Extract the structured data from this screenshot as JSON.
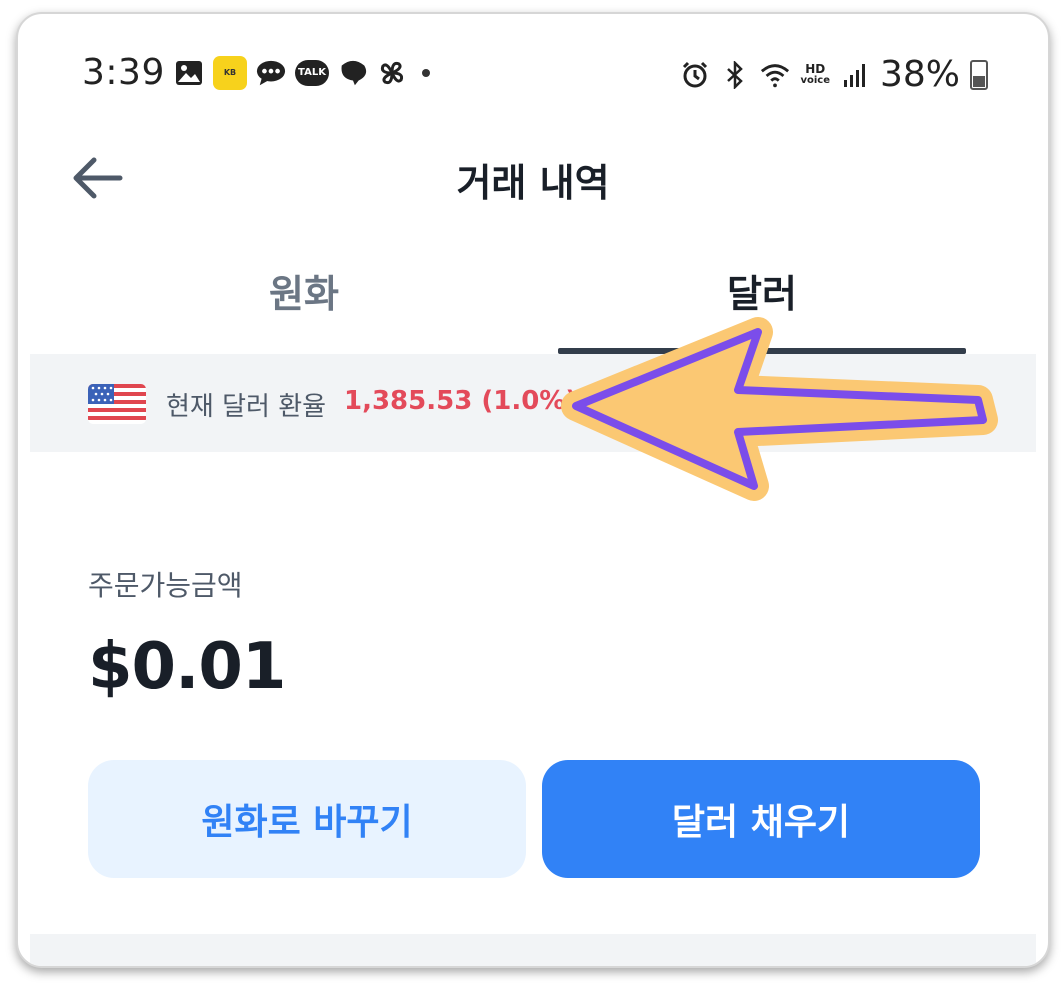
{
  "status_bar": {
    "time": "3:39",
    "kb_label": "KB",
    "talk_label": "TALK",
    "hd_label": "HD",
    "voice_label": "voice",
    "battery": "38%"
  },
  "header": {
    "title": "거래 내역"
  },
  "tabs": [
    {
      "label": "원화",
      "active": false
    },
    {
      "label": "달러",
      "active": true
    }
  ],
  "rate_banner": {
    "label": "현재 달러 환율",
    "value": "1,385.53 (1.0%)"
  },
  "balance": {
    "label": "주문가능금액",
    "value": "$0.01"
  },
  "buttons": {
    "convert_label": "원화로 바꾸기",
    "charge_label": "달러 채우기"
  },
  "colors": {
    "accent": "#3182f6",
    "rate_red": "#e34a5a",
    "arrow_fill": "#fbc873",
    "arrow_stroke": "#7b4dea"
  }
}
